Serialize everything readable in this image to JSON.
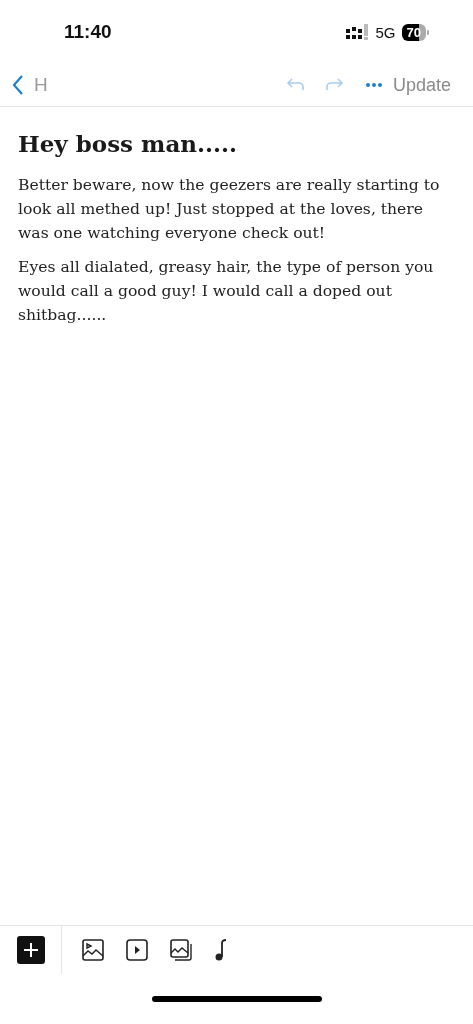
{
  "status_bar": {
    "time": "11:40",
    "network": "5G",
    "battery": "70"
  },
  "nav_bar": {
    "back_label": "H",
    "actions": [
      {
        "kind": "undo",
        "disabled": true
      },
      {
        "kind": "redo",
        "disabled": true
      },
      {
        "kind": "more",
        "disabled": false
      }
    ],
    "update_button": {
      "label": "Update",
      "disabled": true
    }
  },
  "post": {
    "title": "Hey boss man.....",
    "paragraphs": [
      "Better beware, now the geezers are really starting to look all methed up! Just stopped at the loves, there was one watching everyone check out!",
      "Eyes all dialated, greasy hair, the type of person you would call a good guy! I would call a doped out shitbag......"
    ]
  },
  "block_toolbar": [
    {
      "kind": "add"
    },
    {
      "kind": "image"
    },
    {
      "kind": "video"
    },
    {
      "kind": "gallery"
    },
    {
      "kind": "audio"
    }
  ]
}
